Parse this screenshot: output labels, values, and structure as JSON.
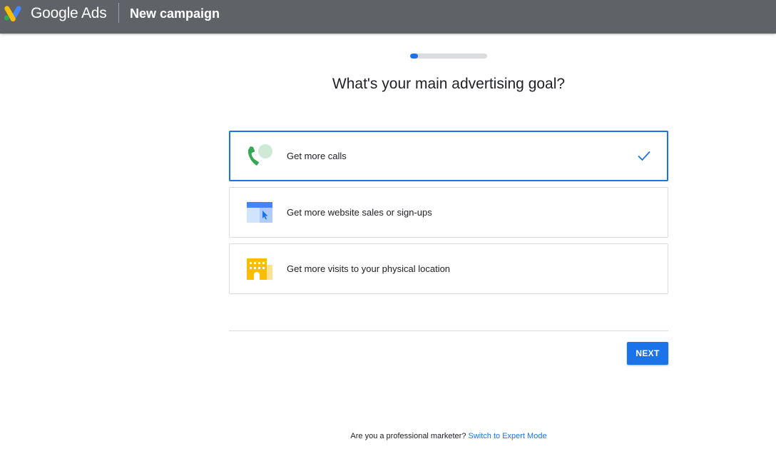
{
  "header": {
    "brand": "Google Ads",
    "title": "New campaign"
  },
  "progress": {
    "value_percent": 10
  },
  "main": {
    "question": "What's your main advertising goal?",
    "options": [
      {
        "label": "Get more calls",
        "icon": "phone-call-icon",
        "selected": true
      },
      {
        "label": "Get more website sales or sign-ups",
        "icon": "website-browser-icon",
        "selected": false
      },
      {
        "label": "Get more visits to your physical location",
        "icon": "storefront-building-icon",
        "selected": false
      }
    ],
    "next_label": "NEXT"
  },
  "footer": {
    "prompt": "Are you a professional marketer?",
    "link": "Switch to Expert Mode"
  },
  "colors": {
    "topbar": "#5f6368",
    "accent": "#1a73e8",
    "border": "#dadce0",
    "google_yellow": "#fbbc04",
    "google_green": "#34a853"
  }
}
